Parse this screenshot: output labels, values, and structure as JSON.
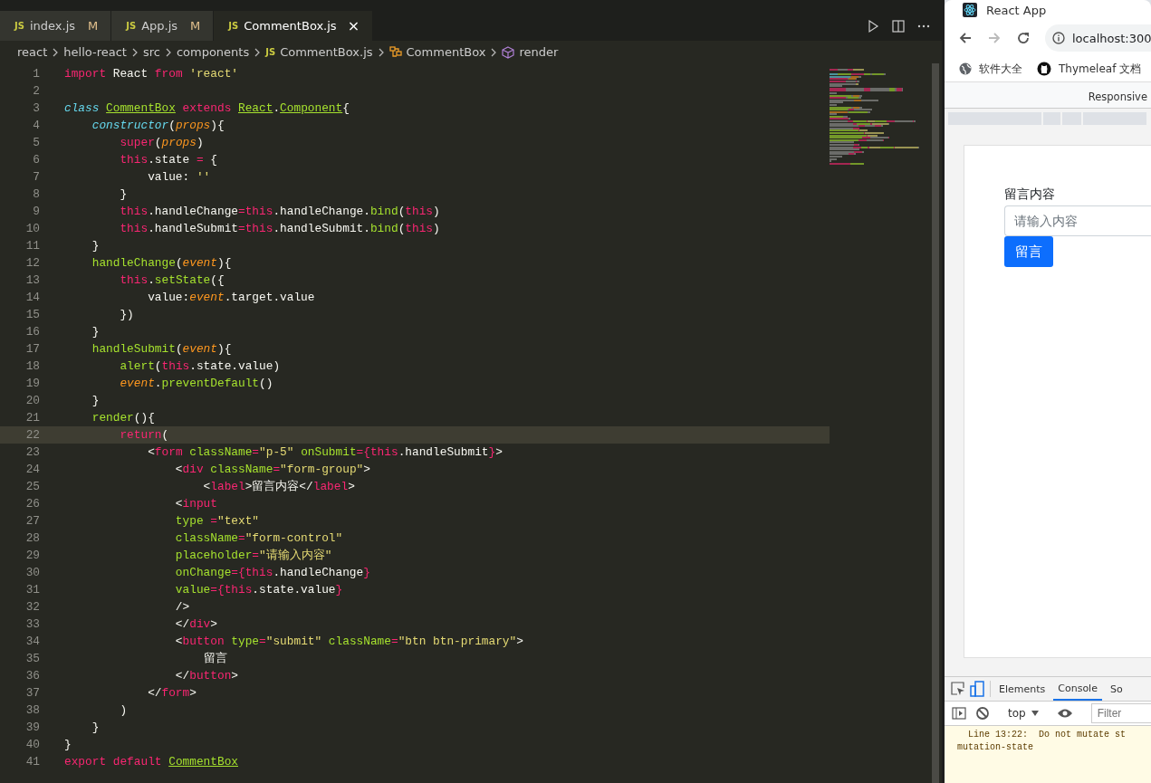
{
  "tabs": [
    {
      "badge": "JS",
      "label": "index.js",
      "status": "M",
      "selected": false
    },
    {
      "badge": "JS",
      "label": "App.js",
      "status": "M",
      "selected": false
    },
    {
      "badge": "JS",
      "label": "CommentBox.js",
      "close": "×",
      "selected": true
    }
  ],
  "breadcrumb": [
    {
      "kind": "folder",
      "label": "react"
    },
    {
      "kind": "folder",
      "label": "hello-react"
    },
    {
      "kind": "folder",
      "label": "src"
    },
    {
      "kind": "folder",
      "label": "components"
    },
    {
      "kind": "file",
      "badge": "JS",
      "label": "CommentBox.js"
    },
    {
      "kind": "class",
      "label": "CommentBox"
    },
    {
      "kind": "method",
      "label": "render"
    }
  ],
  "editor": {
    "lines": [
      {
        "number": "1",
        "tokens": [
          {
            "kind": "keyword",
            "text": "import"
          },
          {
            "kind": "plain",
            "text": " React "
          },
          {
            "kind": "keyword",
            "text": "from"
          },
          {
            "kind": "string",
            "text": " 'react'"
          }
        ]
      },
      {
        "number": "2"
      },
      {
        "number": "3",
        "tokens": [
          {
            "kind": "storage",
            "text": "class "
          },
          {
            "kind": "classname",
            "text": "CommentBox"
          },
          {
            "kind": "keyword",
            "text": " extends "
          },
          {
            "kind": "classname",
            "text": "React"
          },
          {
            "kind": "plain",
            "text": "."
          },
          {
            "kind": "classname",
            "text": "Component"
          },
          {
            "kind": "plain",
            "text": "{"
          }
        ]
      },
      {
        "number": "4",
        "tokens": [
          {
            "kind": "storage",
            "text": "    constructor"
          },
          {
            "kind": "plain",
            "text": "("
          },
          {
            "kind": "param",
            "text": "props"
          },
          {
            "kind": "plain",
            "text": "){"
          }
        ]
      },
      {
        "number": "5",
        "tokens": [
          {
            "kind": "keyword",
            "text": "        super"
          },
          {
            "kind": "plain",
            "text": "("
          },
          {
            "kind": "param",
            "text": "props"
          },
          {
            "kind": "plain",
            "text": ")"
          }
        ]
      },
      {
        "number": "6",
        "tokens": [
          {
            "kind": "keyword",
            "text": "        this"
          },
          {
            "kind": "plain",
            "text": ".state "
          },
          {
            "kind": "keyword",
            "text": "="
          },
          {
            "kind": "plain",
            "text": " {"
          }
        ]
      },
      {
        "number": "7",
        "tokens": [
          {
            "kind": "plain",
            "text": "            value: "
          },
          {
            "kind": "string",
            "text": "''"
          }
        ]
      },
      {
        "number": "8",
        "tokens": [
          {
            "kind": "plain",
            "text": "        }"
          }
        ]
      },
      {
        "number": "9",
        "tokens": [
          {
            "kind": "keyword",
            "text": "        this"
          },
          {
            "kind": "plain",
            "text": ".handleChange"
          },
          {
            "kind": "keyword",
            "text": "=this"
          },
          {
            "kind": "plain",
            "text": ".handleChange."
          },
          {
            "kind": "function",
            "text": "bind"
          },
          {
            "kind": "plain",
            "text": "("
          },
          {
            "kind": "keyword",
            "text": "this"
          },
          {
            "kind": "plain",
            "text": ")"
          }
        ]
      },
      {
        "number": "10",
        "tokens": [
          {
            "kind": "keyword",
            "text": "        this"
          },
          {
            "kind": "plain",
            "text": ".handleSubmit"
          },
          {
            "kind": "keyword",
            "text": "=this"
          },
          {
            "kind": "plain",
            "text": ".handleSubmit."
          },
          {
            "kind": "function",
            "text": "bind"
          },
          {
            "kind": "plain",
            "text": "("
          },
          {
            "kind": "keyword",
            "text": "this"
          },
          {
            "kind": "plain",
            "text": ")"
          }
        ]
      },
      {
        "number": "11",
        "tokens": [
          {
            "kind": "plain",
            "text": "    }"
          }
        ]
      },
      {
        "number": "12",
        "tokens": [
          {
            "kind": "function",
            "text": "    handleChange"
          },
          {
            "kind": "plain",
            "text": "("
          },
          {
            "kind": "param",
            "text": "event"
          },
          {
            "kind": "plain",
            "text": "){"
          }
        ]
      },
      {
        "number": "13",
        "tokens": [
          {
            "kind": "keyword",
            "text": "        this"
          },
          {
            "kind": "plain",
            "text": "."
          },
          {
            "kind": "function",
            "text": "setState"
          },
          {
            "kind": "plain",
            "text": "({"
          }
        ]
      },
      {
        "number": "14",
        "tokens": [
          {
            "kind": "plain",
            "text": "            value:"
          },
          {
            "kind": "param",
            "text": "event"
          },
          {
            "kind": "plain",
            "text": ".target.value"
          }
        ]
      },
      {
        "number": "15",
        "tokens": [
          {
            "kind": "plain",
            "text": "        })"
          }
        ]
      },
      {
        "number": "16",
        "tokens": [
          {
            "kind": "plain",
            "text": "    }"
          }
        ]
      },
      {
        "number": "17",
        "tokens": [
          {
            "kind": "function",
            "text": "    handleSubmit"
          },
          {
            "kind": "plain",
            "text": "("
          },
          {
            "kind": "param",
            "text": "event"
          },
          {
            "kind": "plain",
            "text": "){"
          }
        ]
      },
      {
        "number": "18",
        "tokens": [
          {
            "kind": "function",
            "text": "        alert"
          },
          {
            "kind": "plain",
            "text": "("
          },
          {
            "kind": "keyword",
            "text": "this"
          },
          {
            "kind": "plain",
            "text": ".state.value)"
          }
        ]
      },
      {
        "number": "19",
        "tokens": [
          {
            "kind": "param",
            "text": "        event"
          },
          {
            "kind": "plain",
            "text": "."
          },
          {
            "kind": "function",
            "text": "preventDefault"
          },
          {
            "kind": "plain",
            "text": "()"
          }
        ]
      },
      {
        "number": "20",
        "tokens": [
          {
            "kind": "plain",
            "text": "    }"
          }
        ]
      },
      {
        "number": "21",
        "tokens": [
          {
            "kind": "function",
            "text": "    render"
          },
          {
            "kind": "plain",
            "text": "(){"
          }
        ]
      },
      {
        "number": "22",
        "current": true,
        "tokens": [
          {
            "kind": "keyword",
            "text": "        return"
          },
          {
            "kind": "plain",
            "text": "("
          }
        ]
      },
      {
        "number": "23",
        "tokens": [
          {
            "kind": "plain",
            "text": "            <"
          },
          {
            "kind": "keyword",
            "text": "form"
          },
          {
            "kind": "function",
            "text": " className"
          },
          {
            "kind": "keyword",
            "text": "="
          },
          {
            "kind": "string",
            "text": "\"p-5\""
          },
          {
            "kind": "function",
            "text": " onSubmit"
          },
          {
            "kind": "keyword",
            "text": "={this"
          },
          {
            "kind": "plain",
            "text": ".handleSubmit"
          },
          {
            "kind": "keyword",
            "text": "}"
          },
          {
            "kind": "plain",
            "text": ">"
          }
        ]
      },
      {
        "number": "24",
        "tokens": [
          {
            "kind": "plain",
            "text": "                <"
          },
          {
            "kind": "keyword",
            "text": "div"
          },
          {
            "kind": "function",
            "text": " className"
          },
          {
            "kind": "keyword",
            "text": "="
          },
          {
            "kind": "string",
            "text": "\"form-group\""
          },
          {
            "kind": "plain",
            "text": ">"
          }
        ]
      },
      {
        "number": "25",
        "tokens": [
          {
            "kind": "plain",
            "text": "                    <"
          },
          {
            "kind": "keyword",
            "text": "label"
          },
          {
            "kind": "plain",
            "text": ">留言内容</"
          },
          {
            "kind": "keyword",
            "text": "label"
          },
          {
            "kind": "plain",
            "text": ">"
          }
        ]
      },
      {
        "number": "26",
        "tokens": [
          {
            "kind": "plain",
            "text": "                <"
          },
          {
            "kind": "keyword",
            "text": "input"
          }
        ]
      },
      {
        "number": "27",
        "tokens": [
          {
            "kind": "function",
            "text": "                type "
          },
          {
            "kind": "keyword",
            "text": "="
          },
          {
            "kind": "string",
            "text": "\"text\""
          }
        ]
      },
      {
        "number": "28",
        "tokens": [
          {
            "kind": "function",
            "text": "                className"
          },
          {
            "kind": "keyword",
            "text": "="
          },
          {
            "kind": "string",
            "text": "\"form-control\""
          }
        ]
      },
      {
        "number": "29",
        "tokens": [
          {
            "kind": "function",
            "text": "                placeholder"
          },
          {
            "kind": "keyword",
            "text": "="
          },
          {
            "kind": "string",
            "text": "\"请输入内容\""
          }
        ]
      },
      {
        "number": "30",
        "tokens": [
          {
            "kind": "function",
            "text": "                onChange"
          },
          {
            "kind": "keyword",
            "text": "={this"
          },
          {
            "kind": "plain",
            "text": ".handleChange"
          },
          {
            "kind": "keyword",
            "text": "}"
          }
        ]
      },
      {
        "number": "31",
        "tokens": [
          {
            "kind": "function",
            "text": "                value"
          },
          {
            "kind": "keyword",
            "text": "={this"
          },
          {
            "kind": "plain",
            "text": ".state.value"
          },
          {
            "kind": "keyword",
            "text": "}"
          }
        ]
      },
      {
        "number": "32",
        "tokens": [
          {
            "kind": "plain",
            "text": "                />"
          }
        ]
      },
      {
        "number": "33",
        "tokens": [
          {
            "kind": "plain",
            "text": "                </"
          },
          {
            "kind": "keyword",
            "text": "div"
          },
          {
            "kind": "plain",
            "text": ">"
          }
        ]
      },
      {
        "number": "34",
        "tokens": [
          {
            "kind": "plain",
            "text": "                <"
          },
          {
            "kind": "keyword",
            "text": "button"
          },
          {
            "kind": "function",
            "text": " type"
          },
          {
            "kind": "keyword",
            "text": "="
          },
          {
            "kind": "string",
            "text": "\"submit\""
          },
          {
            "kind": "function",
            "text": " className"
          },
          {
            "kind": "keyword",
            "text": "="
          },
          {
            "kind": "string",
            "text": "\"btn btn-primary\""
          },
          {
            "kind": "plain",
            "text": ">"
          }
        ]
      },
      {
        "number": "35",
        "tokens": [
          {
            "kind": "plain",
            "text": "                    留言"
          }
        ]
      },
      {
        "number": "36",
        "tokens": [
          {
            "kind": "plain",
            "text": "                </"
          },
          {
            "kind": "keyword",
            "text": "button"
          },
          {
            "kind": "plain",
            "text": ">"
          }
        ]
      },
      {
        "number": "37",
        "tokens": [
          {
            "kind": "plain",
            "text": "            </"
          },
          {
            "kind": "keyword",
            "text": "form"
          },
          {
            "kind": "plain",
            "text": ">"
          }
        ]
      },
      {
        "number": "38",
        "tokens": [
          {
            "kind": "plain",
            "text": "        )"
          }
        ]
      },
      {
        "number": "39",
        "tokens": [
          {
            "kind": "plain",
            "text": "    }"
          }
        ]
      },
      {
        "number": "40",
        "tokens": [
          {
            "kind": "plain",
            "text": "}"
          }
        ]
      },
      {
        "number": "41",
        "tokens": [
          {
            "kind": "keyword",
            "text": "export default "
          },
          {
            "kind": "classname",
            "text": "CommentBox"
          }
        ]
      }
    ]
  },
  "browser": {
    "tab_title": "React App",
    "address": "localhost:300",
    "bookmarks": [
      {
        "kind": "globe",
        "label": "软件大全"
      },
      {
        "kind": "github",
        "label": "Thymeleaf 文档"
      }
    ],
    "device_toolbar": "Responsive",
    "page": {
      "label": "留言内容",
      "placeholder": "请输入内容",
      "button": "留言"
    },
    "devtools": {
      "tabs": [
        {
          "label": "Elements",
          "selected": false
        },
        {
          "label": "Console",
          "selected": true
        },
        {
          "label": "So",
          "selected": false
        }
      ],
      "context": "top",
      "filter_placeholder": "Filter",
      "messages": [
        "  Line 13:22:  Do not mutate st",
        "mutation-state"
      ]
    }
  }
}
